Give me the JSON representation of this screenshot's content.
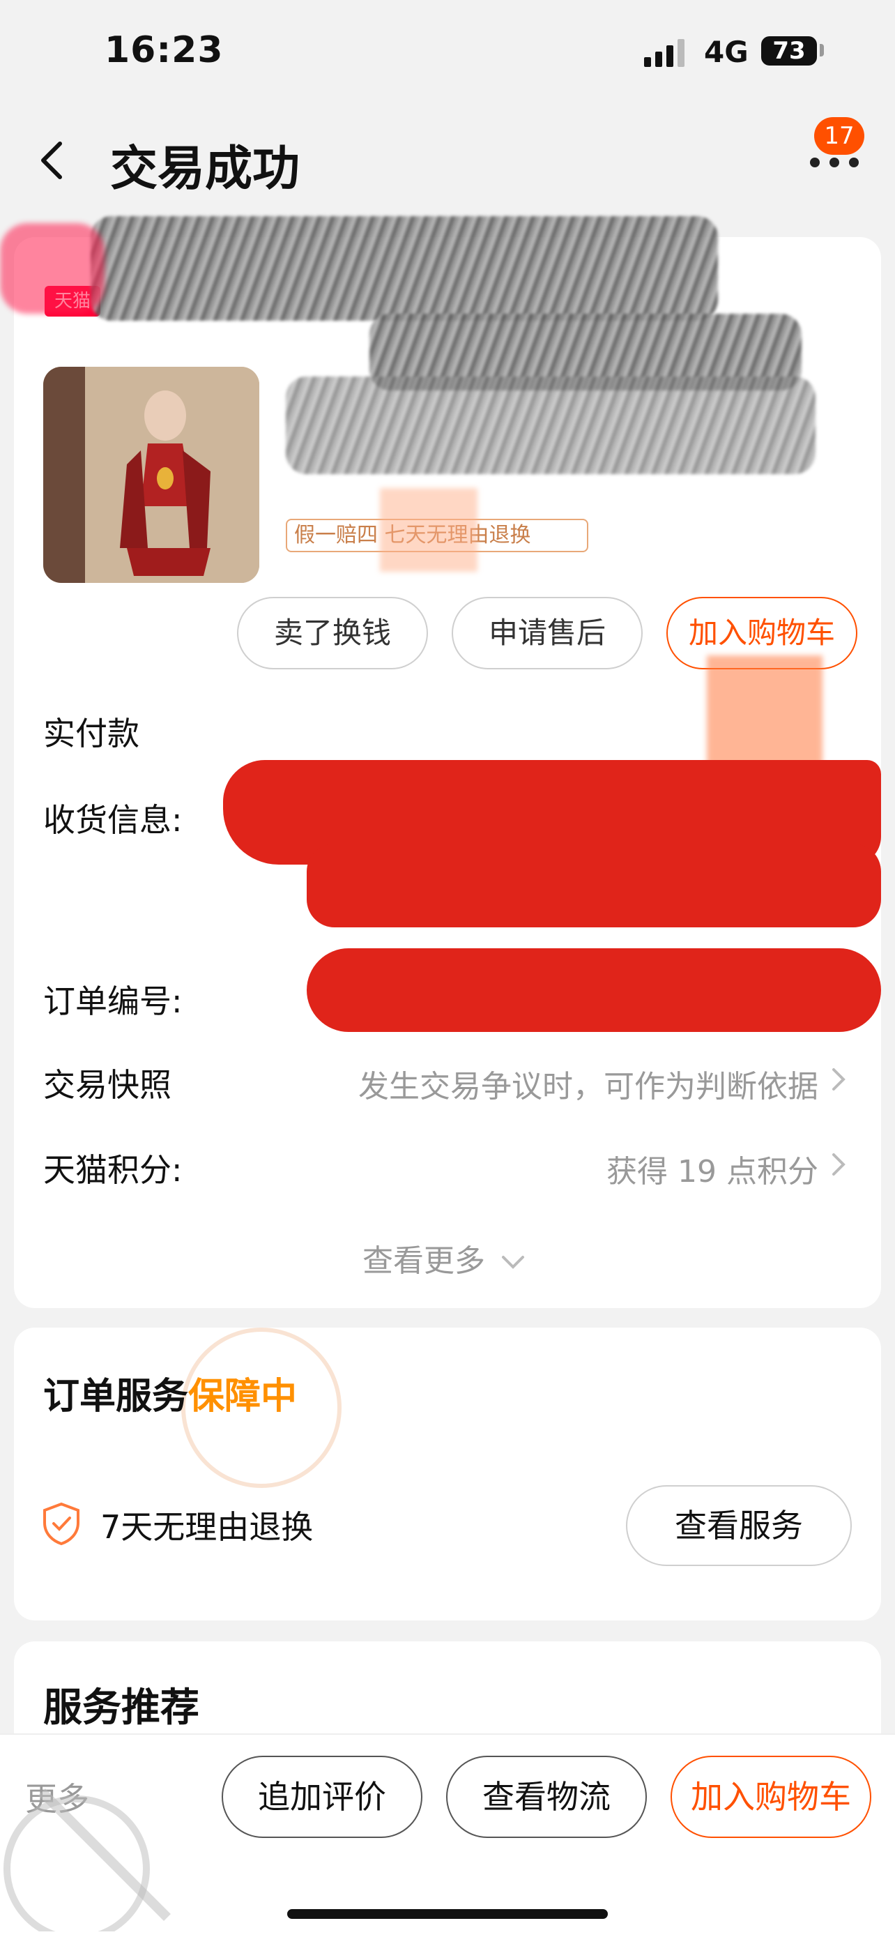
{
  "status_bar": {
    "time": "16:23",
    "network": "4G",
    "battery": "73"
  },
  "header": {
    "title": "交易成功",
    "notification_count": "17"
  },
  "order": {
    "shop_tag": "天猫",
    "guarantee_tag": "假一赔四 七天无理由退换",
    "actions": [
      "卖了换钱",
      "申请售后",
      "加入购物车"
    ],
    "rows": {
      "paid_label": "实付款",
      "address_label": "收货信息:",
      "order_no_label": "订单编号:",
      "snapshot_label": "交易快照",
      "snapshot_value": "发生交易争议时，可作为判断依据",
      "points_label": "天猫积分:",
      "points_value": "获得 19 点积分"
    },
    "see_more": "查看更多"
  },
  "service": {
    "title": "订单服务",
    "status": "保障中",
    "item": "7天无理由退换",
    "button": "查看服务"
  },
  "recommend": {
    "title": "服务推荐"
  },
  "bottom_bar": {
    "more": "更多",
    "buttons": [
      "追加评价",
      "查看物流",
      "加入购物车"
    ]
  },
  "colors": {
    "accent": "#ff5000",
    "service_status": "#ff9000",
    "redact_red": "#e0241a"
  }
}
